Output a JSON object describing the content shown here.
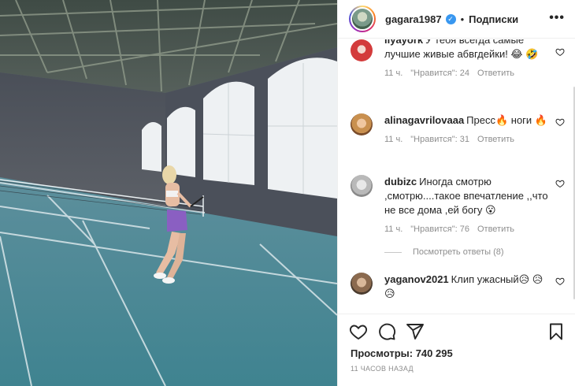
{
  "post": {
    "username": "gagara1987",
    "separator": "•",
    "follow_label": "Подписки",
    "more_label": "•••"
  },
  "comments": [
    {
      "user": "ilyayork",
      "text": "У тебя всегда самые лучшие живые абвгдейки! 😂 🤣",
      "time": "11 ч.",
      "likes": "\"Нравится\": 24",
      "reply": "Ответить"
    },
    {
      "user": "alinagavrilovaaa",
      "text": "Пресс🔥 ноги 🔥",
      "time": "11 ч.",
      "likes": "\"Нравится\": 31",
      "reply": "Ответить"
    },
    {
      "user": "dubizc",
      "text": "Иногда смотрю ,смотрю....такое впечатление ,,что не все дома ,ей богу 😮",
      "time": "11 ч.",
      "likes": "\"Нравится\": 76",
      "reply": "Ответить",
      "view_replies": "Посмотреть ответы (8)"
    },
    {
      "user": "yaganov2021",
      "text": "Клип ужасный😥 😥😥",
      "time": "",
      "likes": "",
      "reply": ""
    }
  ],
  "stats": {
    "views": "Просмотры: 740 295",
    "posted": "11 ЧАСОВ НАЗАД"
  },
  "icons": [
    "verified-badge",
    "heart-icon",
    "comment-icon",
    "share-icon",
    "bookmark-icon",
    "more-options-icon"
  ],
  "colors": {
    "court": "#3f8f9e",
    "verified": "#3897f0",
    "text": "#262626",
    "muted": "#8e8e8e"
  }
}
